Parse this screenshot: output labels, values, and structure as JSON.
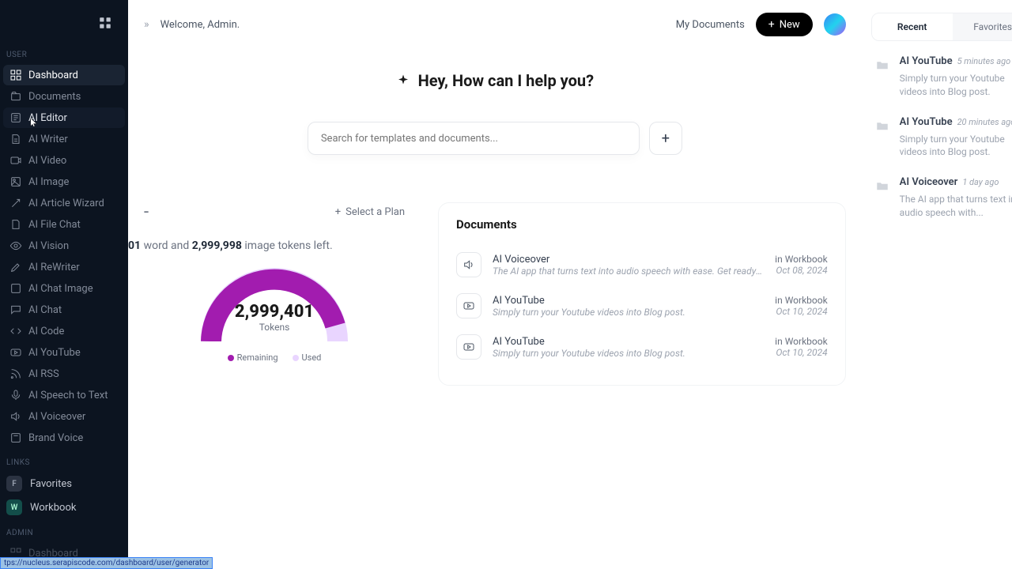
{
  "sidebar": {
    "sections": {
      "user": "USER",
      "links": "LINKS",
      "admin": "ADMIN"
    },
    "items": [
      {
        "label": "Dashboard"
      },
      {
        "label": "Documents"
      },
      {
        "label": "AI Editor"
      },
      {
        "label": "AI Writer"
      },
      {
        "label": "AI Video"
      },
      {
        "label": "AI Image"
      },
      {
        "label": "AI Article Wizard"
      },
      {
        "label": "AI File Chat"
      },
      {
        "label": "AI Vision"
      },
      {
        "label": "AI ReWriter"
      },
      {
        "label": "AI Chat Image"
      },
      {
        "label": "AI Chat"
      },
      {
        "label": "AI Code"
      },
      {
        "label": "AI YouTube"
      },
      {
        "label": "AI RSS"
      },
      {
        "label": "AI Speech to Text"
      },
      {
        "label": "AI Voiceover"
      },
      {
        "label": "Brand Voice"
      }
    ],
    "links": [
      {
        "chip": "F",
        "label": "Favorites"
      },
      {
        "chip": "W",
        "label": "Workbook"
      }
    ],
    "admin_item": {
      "label": "Dashboard"
    },
    "status_url": "tps://nucleus.serapiscode.com/dashboard/user/generator"
  },
  "header": {
    "welcome": "Welcome, Admin.",
    "my_documents": "My Documents",
    "new_label": "New"
  },
  "hero": {
    "title": "Hey, How can I help you?"
  },
  "search": {
    "placeholder": "Search for templates and documents..."
  },
  "plan": {
    "dash": "-",
    "select_label": "Select a Plan",
    "word_prefix": "01",
    "word_text": "word and",
    "image_tokens": "2,999,998",
    "image_suffix": "image tokens left."
  },
  "gauge": {
    "number": "2,999,401",
    "unit": "Tokens",
    "legend_remaining": "Remaining",
    "legend_used": "Used"
  },
  "documents": {
    "title": "Documents",
    "rows": [
      {
        "name": "AI Voiceover",
        "desc": "The AI app that turns text into audio speech with ease. Get ready to...",
        "loc": "in Workbook",
        "date": "Oct 08, 2024",
        "icon": "voiceover"
      },
      {
        "name": "AI YouTube",
        "desc": "Simply turn your Youtube videos into Blog post.",
        "loc": "in Workbook",
        "date": "Oct 10, 2024",
        "icon": "youtube"
      },
      {
        "name": "AI YouTube",
        "desc": "Simply turn your Youtube videos into Blog post.",
        "loc": "in Workbook",
        "date": "Oct 10, 2024",
        "icon": "youtube"
      }
    ]
  },
  "right": {
    "tabs": {
      "recent": "Recent",
      "favorites": "Favorites"
    },
    "feed": [
      {
        "title": "AI YouTube",
        "time": "5 minutes ago",
        "desc": "Simply turn your Youtube videos into Blog post."
      },
      {
        "title": "AI YouTube",
        "time": "20 minutes ago",
        "desc": "Simply turn your Youtube videos into Blog post."
      },
      {
        "title": "AI Voiceover",
        "time": "1 day ago",
        "desc": "The AI app that turns text into audio speech with..."
      }
    ]
  }
}
